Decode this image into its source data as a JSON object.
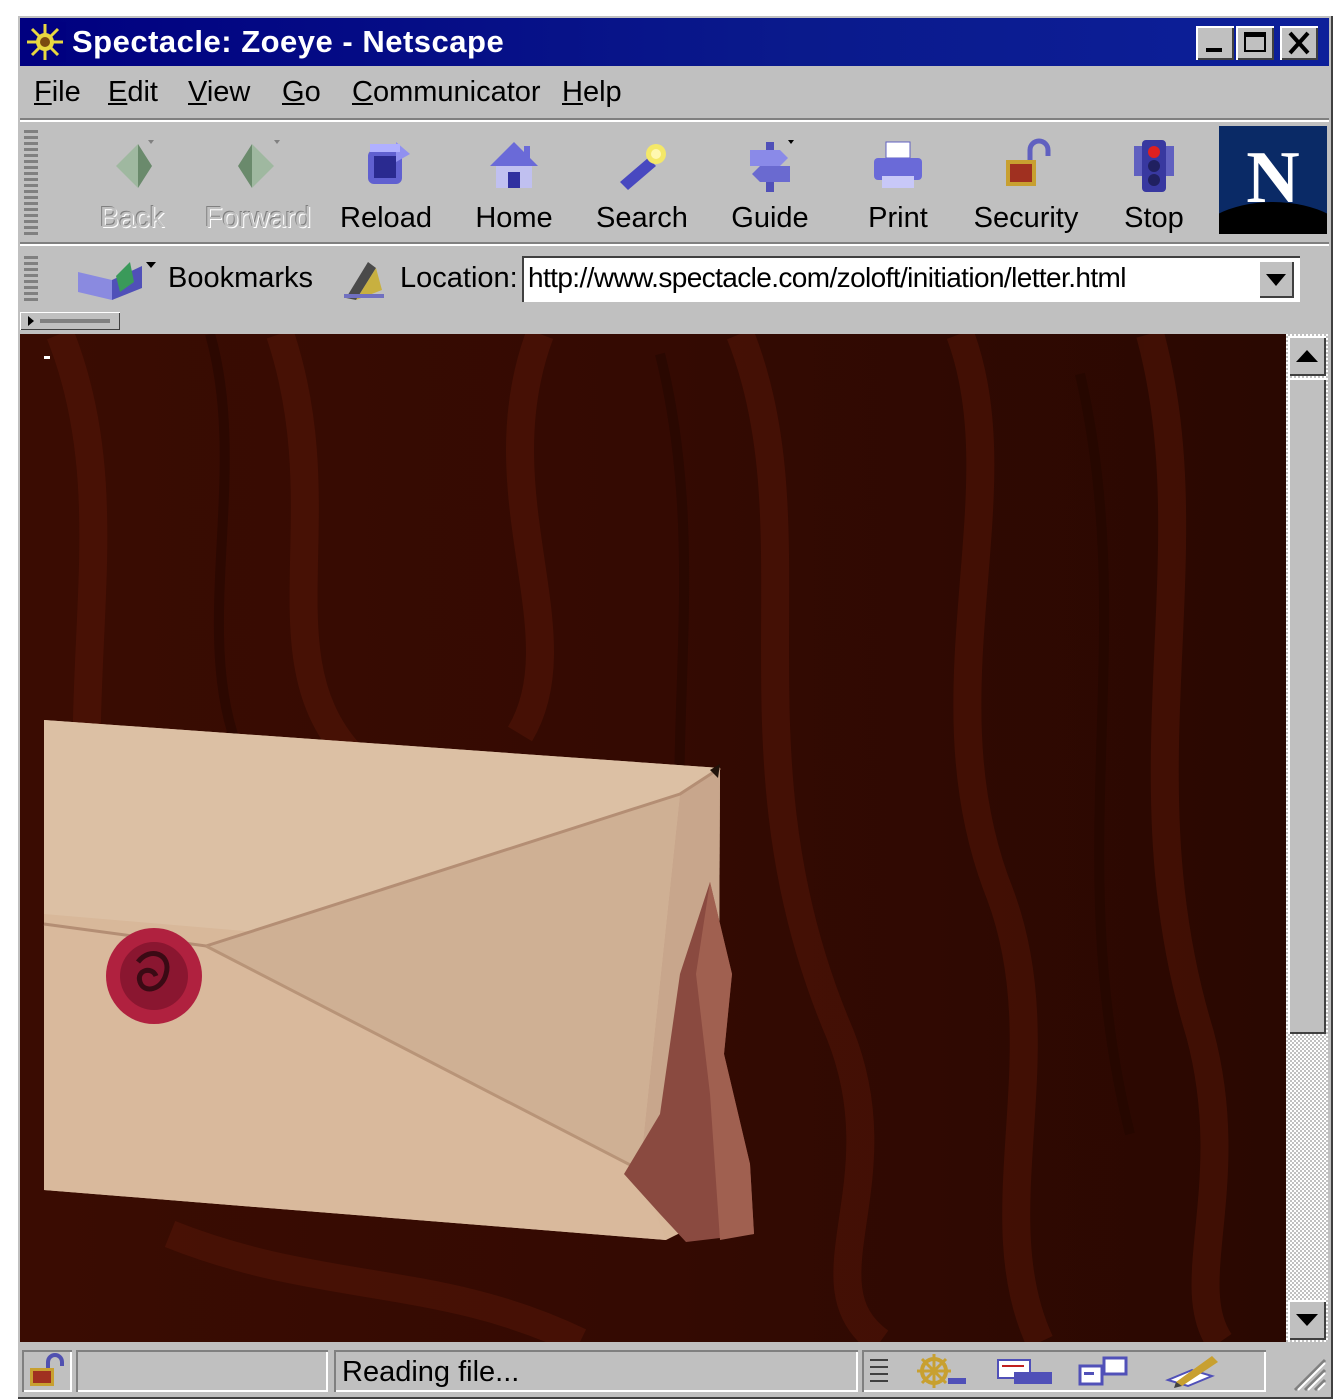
{
  "window": {
    "title": "Spectacle: Zoeye - Netscape",
    "controls": [
      "minimize",
      "maximize",
      "close"
    ]
  },
  "menu": {
    "items": [
      {
        "label": "File",
        "ul": "F",
        "rest": "ile"
      },
      {
        "label": "Edit",
        "ul": "E",
        "rest": "dit"
      },
      {
        "label": "View",
        "ul": "V",
        "rest": "iew"
      },
      {
        "label": "Go",
        "ul": "G",
        "rest": "o"
      },
      {
        "label": "Communicator",
        "ul": "C",
        "rest": "ommunicator"
      },
      {
        "label": "Help",
        "ul": "H",
        "rest": "elp"
      }
    ]
  },
  "toolbar": {
    "buttons": [
      {
        "label": "Back",
        "icon": "back-arrow-icon",
        "enabled": false
      },
      {
        "label": "Forward",
        "icon": "forward-arrow-icon",
        "enabled": false
      },
      {
        "label": "Reload",
        "icon": "reload-icon",
        "enabled": true
      },
      {
        "label": "Home",
        "icon": "home-icon",
        "enabled": true
      },
      {
        "label": "Search",
        "icon": "search-flashlight-icon",
        "enabled": true
      },
      {
        "label": "Guide",
        "icon": "guide-signpost-icon",
        "enabled": true
      },
      {
        "label": "Print",
        "icon": "printer-icon",
        "enabled": true
      },
      {
        "label": "Security",
        "icon": "padlock-icon",
        "enabled": true
      },
      {
        "label": "Stop",
        "icon": "stop-traffic-light-icon",
        "enabled": true
      }
    ],
    "logo_letter": "N"
  },
  "location_bar": {
    "bookmarks_label": "Bookmarks",
    "location_label": "Location:",
    "url": "http://www.spectacle.com/zoloft/initiation/letter.html"
  },
  "status_bar": {
    "text": "Reading file..."
  },
  "colors": {
    "titlebar": "#000080",
    "chrome": "#c0c0c0",
    "wood": "#3a0a02",
    "envelope": "#d4b296",
    "wax_seal": "#b0213f"
  }
}
